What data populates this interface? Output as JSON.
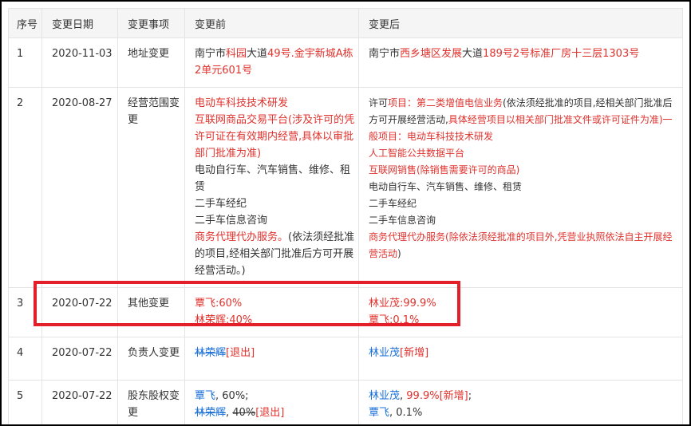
{
  "headers": {
    "index": "序号",
    "date": "变更日期",
    "item": "变更事项",
    "before": "变更前",
    "after": "变更后"
  },
  "rows": [
    {
      "index": "1",
      "date": "2020-11-03",
      "item": "地址变更",
      "before": {
        "a": "南宁市",
        "b": "科园",
        "c": "大道",
        "d": "49号.金宇新城A栋2单元601号"
      },
      "after": {
        "a": "南宁市",
        "b": "西乡塘区发展",
        "c": "大道",
        "d": "189号2号标准厂房十三层1303号"
      }
    },
    {
      "index": "2",
      "date": "2020-08-27",
      "item": "经营范围变更",
      "before": {
        "l1": "电动车科技技术研发",
        "l2": "互联网商品交易平台(涉及许可的凭许可证在有效期内经营,具体以审批部门批准为准)",
        "l3": "电动自行车、汽车销售、维修、租赁",
        "l4": "二手车经纪",
        "l5": "二手车信息咨询",
        "l6a": "商务代理代办服务。",
        "l6b": "(依法须经批准的项目,经相关部门批准后方可开展经营活动。)"
      },
      "after": {
        "l1a": "许可",
        "l1b": "项目：第二类增值电信业务",
        "l1c": "(依法须经批准的项目,经相关部门批准后方可开展经营活动,",
        "l1d": "具体经营项目以相关部门批准文件或许可证件为准)一般项目：电动车科技技术研发",
        "l2": "人工智能公共数据平台",
        "l3": "互联网销售(除销售需要许可的商品)",
        "l4": "电动自行车、汽车销售、维修、租赁",
        "l5": "二手车经纪",
        "l6": "二手车信息咨询",
        "l7a": "商务代理代办服务",
        "l7b": "(除依法须经批准的项目外,凭营业执照依法自主开展经营活动",
        "l7c": ")"
      }
    },
    {
      "index": "3",
      "date": "2020-07-22",
      "item": "其他变更",
      "before": {
        "l1": "覃飞:60%",
        "l2": "林荣辉:40%"
      },
      "after": {
        "l1": "林业茂:99.9%",
        "l2": "覃飞:0.1%"
      }
    },
    {
      "index": "4",
      "date": "2020-07-22",
      "item": "负责人变更",
      "before": {
        "name": "林荣辉",
        "tag": "[退出]"
      },
      "after": {
        "name": "林业茂",
        "tag": "[新增]"
      }
    },
    {
      "index": "5",
      "date": "2020-07-22",
      "item": "股东股权变更",
      "before": {
        "n1": "覃飞",
        "p1": ", 60%;",
        "n2": "林荣辉",
        "sep2": ", ",
        "p2": "40%",
        "tag2": "[退出]"
      },
      "after": {
        "n1": "林业茂",
        "sep1": ", ",
        "p1": "99.9%",
        "tag1": "[新增]",
        "end1": ";",
        "n2": "覃飞",
        "p2": ", 0.1%"
      }
    }
  ],
  "colors": {
    "highlight": "#e3202a",
    "changed_text": "#e0322d",
    "link": "#1a6fd8"
  }
}
